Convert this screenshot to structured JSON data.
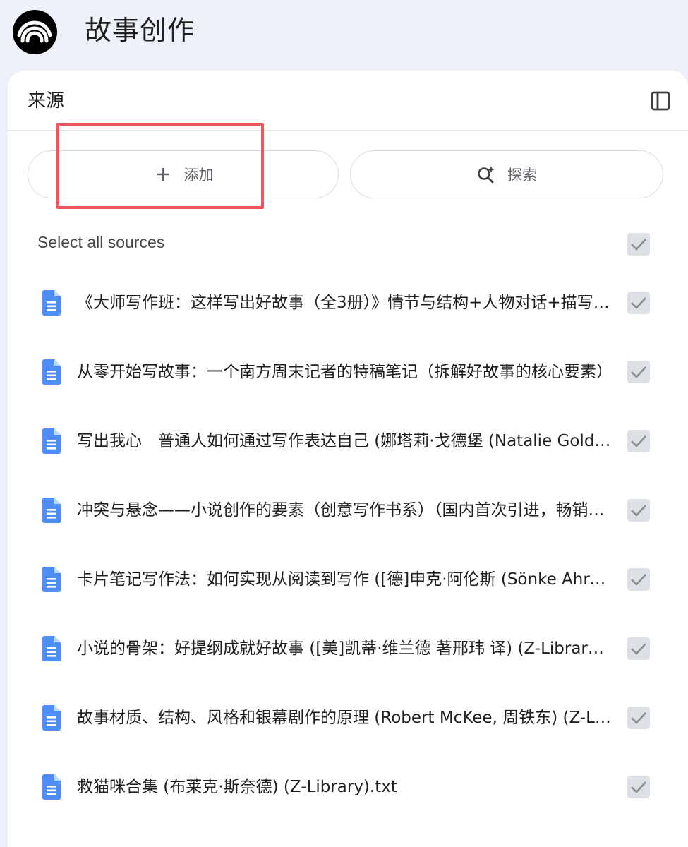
{
  "app": {
    "title": "故事创作",
    "logo_icon": "notebook-logo-icon"
  },
  "panel": {
    "title": "来源",
    "collapse_icon": "side-panel-icon"
  },
  "actions": {
    "add_label": "添加",
    "add_icon": "plus-icon",
    "discover_label": "探索",
    "discover_icon": "sparkle-search-icon"
  },
  "select_all": {
    "label": "Select all sources",
    "checked": true
  },
  "sources": [
    {
      "title": "《大师写作班：这样写出好故事（全3册）》情节与结构+人物对话+描写与背景",
      "checked": true
    },
    {
      "title": "从零开始写故事：一个南方周末记者的特稿笔记（拆解好故事的核心要素）",
      "checked": true
    },
    {
      "title": "写出我心　普通人如何通过写作表达自己 (娜塔莉·戈德堡 (Natalie Goldberg))",
      "checked": true
    },
    {
      "title": "冲突与悬念——小说创作的要素（创意写作书系）（国内首次引进，畅销经典）",
      "checked": true
    },
    {
      "title": "卡片笔记写作法：如何实现从阅读到写作 ([德]申克·阿伦斯 (Sönke Ahrens))",
      "checked": true
    },
    {
      "title": "小说的骨架：好提纲成就好故事 ([美]凯蒂·维兰德 著邢玮 译) (Z-Library).txt",
      "checked": true
    },
    {
      "title": "故事材质、结构、风格和银幕剧作的原理 (Robert McKee, 周铁东) (Z-Library).txt",
      "checked": true
    },
    {
      "title": "救猫咪合集 (布莱克·斯奈德) (Z-Library).txt",
      "checked": true
    }
  ],
  "colors": {
    "page_bg": "#eef0fa",
    "doc_icon": "#4f8ef7",
    "highlight": "#f0555b",
    "checkbox_bg": "#dde0e4"
  }
}
